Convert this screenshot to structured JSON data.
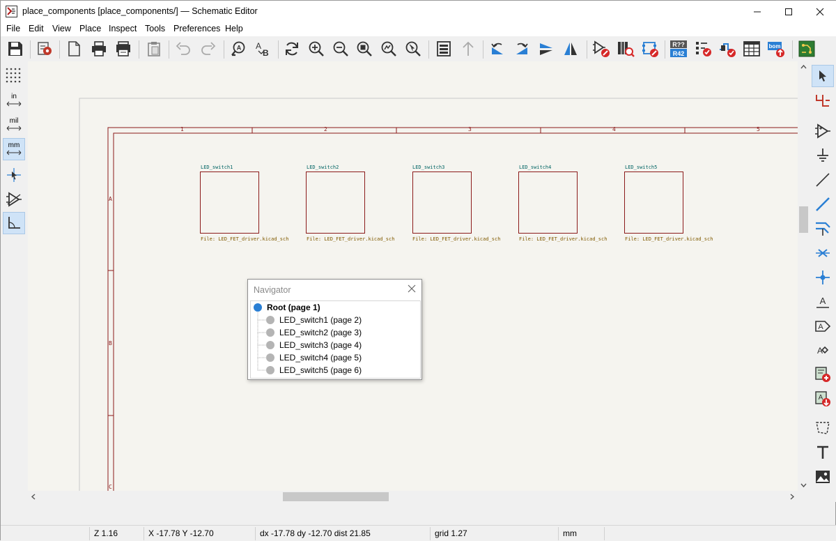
{
  "window": {
    "title": "place_components [place_components/] — Schematic Editor"
  },
  "menu": [
    "File",
    "Edit",
    "View",
    "Place",
    "Inspect",
    "Tools",
    "Preferences",
    "Help"
  ],
  "toolbar": {
    "annotate_label": "R??\nR42",
    "bom_label": "bom"
  },
  "left_toolbar": {
    "in_label": "in",
    "mil_label": "mil",
    "mm_label": "mm"
  },
  "schematic": {
    "border_columns": [
      "1",
      "2",
      "3",
      "4",
      "5"
    ],
    "border_rows": [
      "A",
      "B",
      "C"
    ],
    "sheets": [
      {
        "name": "LED_switch1",
        "file": "File: LED_FET_driver.kicad_sch"
      },
      {
        "name": "LED_switch2",
        "file": "File: LED_FET_driver.kicad_sch"
      },
      {
        "name": "LED_switch3",
        "file": "File: LED_FET_driver.kicad_sch"
      },
      {
        "name": "LED_switch4",
        "file": "File: LED_FET_driver.kicad_sch"
      },
      {
        "name": "LED_switch5",
        "file": "File: LED_FET_driver.kicad_sch"
      }
    ],
    "colors": {
      "border": "#8b1a1a",
      "sheet_name": "#006464",
      "sheet_file": "#805a00",
      "background": "#f5f4ef"
    }
  },
  "navigator": {
    "title": "Navigator",
    "root": "Root (page 1)",
    "items": [
      "LED_switch1 (page 2)",
      "LED_switch2 (page 3)",
      "LED_switch3 (page 4)",
      "LED_switch4 (page 5)",
      "LED_switch5 (page 6)"
    ],
    "colors": {
      "root_dot": "#2a7fd4",
      "item_dot": "#b4b4b4"
    }
  },
  "status": {
    "zoom": "Z 1.16",
    "cursor": "X -17.78  Y -12.70",
    "delta": "dx -17.78  dy -12.70  dist 21.85",
    "grid": "grid 1.27",
    "units": "mm"
  }
}
